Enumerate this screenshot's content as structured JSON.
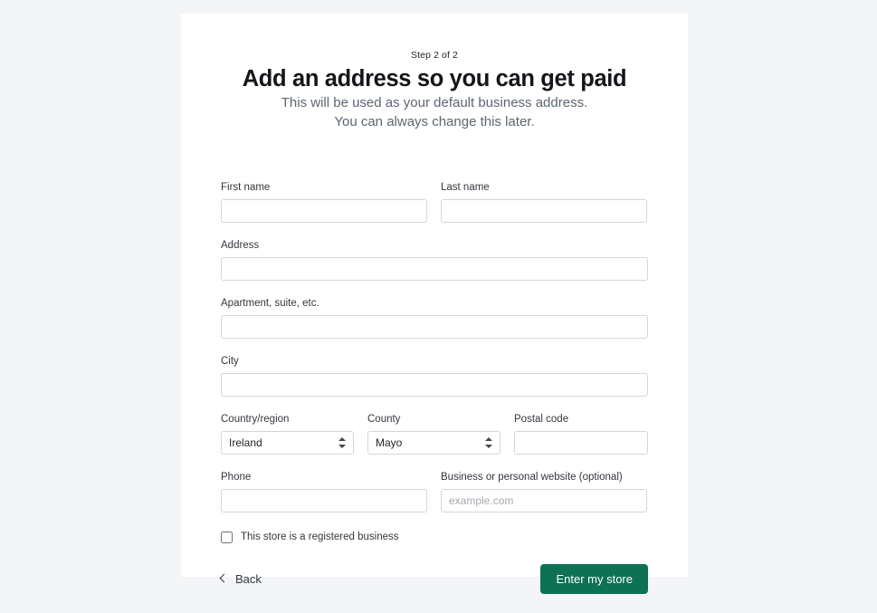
{
  "header": {
    "step": "Step 2 of 2",
    "title": "Add an address so you can get paid",
    "subtitle_line1": "This will be used as your default business address.",
    "subtitle_line2": "You can always change this later."
  },
  "form": {
    "first_name": {
      "label": "First name",
      "value": "",
      "placeholder": ""
    },
    "last_name": {
      "label": "Last name",
      "value": "",
      "placeholder": ""
    },
    "address": {
      "label": "Address",
      "value": "",
      "placeholder": ""
    },
    "apartment": {
      "label": "Apartment, suite, etc.",
      "value": "",
      "placeholder": ""
    },
    "city": {
      "label": "City",
      "value": "",
      "placeholder": ""
    },
    "country": {
      "label": "Country/region",
      "value": "Ireland"
    },
    "county": {
      "label": "County",
      "value": "Mayo"
    },
    "postal_code": {
      "label": "Postal code",
      "value": "",
      "placeholder": ""
    },
    "phone": {
      "label": "Phone",
      "value": "",
      "placeholder": ""
    },
    "website": {
      "label": "Business or personal website (optional)",
      "value": "",
      "placeholder": "example.com"
    },
    "registered_business": {
      "label": "This store is a registered business",
      "checked": false
    }
  },
  "footer": {
    "back_label": "Back",
    "submit_label": "Enter my store"
  },
  "colors": {
    "page_background": "#f4f5f7",
    "card_background": "#ffffff",
    "primary_button": "#0d7153",
    "input_border": "#d3d6da",
    "subtitle_text": "#5c6672",
    "label_text": "#33373d"
  }
}
